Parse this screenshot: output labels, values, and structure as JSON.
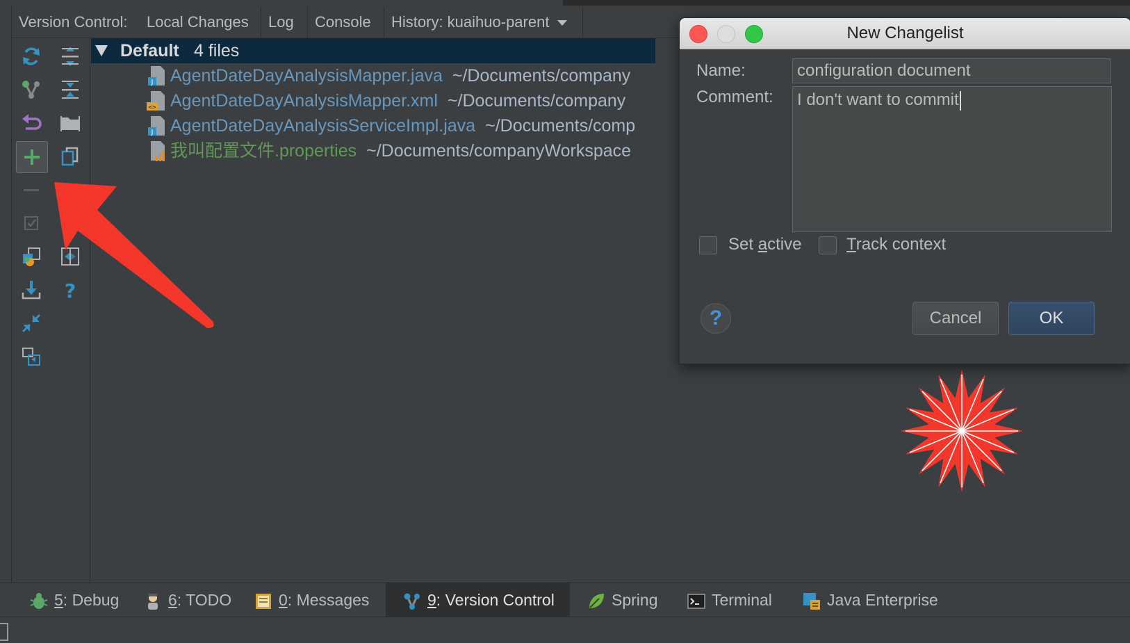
{
  "tabs": {
    "prefix": "Version Control:",
    "local_changes": "Local Changes",
    "log": "Log",
    "console": "Console",
    "history": "History: kuaihuo-parent"
  },
  "changelist": {
    "name": "Default",
    "count": "4 files",
    "files": [
      {
        "name": "AgentDateDayAnalysisMapper.java",
        "path": "~/Documents/company",
        "color": "#6897bb",
        "icon": "java-file-icon"
      },
      {
        "name": "AgentDateDayAnalysisMapper.xml",
        "path": "~/Documents/company",
        "color": "#6897bb",
        "icon": "xml-file-icon"
      },
      {
        "name": "AgentDateDayAnalysisServiceImpl.java",
        "path": "~/Documents/comp",
        "color": "#6897bb",
        "icon": "java-file-icon"
      },
      {
        "name": "我叫配置文件.properties",
        "path": "~/Documents/companyWorkspace",
        "color": "#629755",
        "icon": "properties-file-icon"
      }
    ]
  },
  "dialog": {
    "title": "New Changelist",
    "name_label": "Name:",
    "name_value": "configuration document",
    "comment_label": "Comment:",
    "comment_value": "I don't want to commit",
    "set_active": {
      "pre": "Set ",
      "mn": "a",
      "post": "ctive"
    },
    "track_context": {
      "pre": "",
      "mn": "T",
      "post": "rack context"
    },
    "help": "?",
    "cancel": "Cancel",
    "ok": "OK"
  },
  "bottom_tabs": [
    {
      "num": "5",
      "label": ": Debug",
      "icon": "debug-icon"
    },
    {
      "num": "6",
      "label": ": TODO",
      "icon": "todo-icon"
    },
    {
      "num": "0",
      "label": ": Messages",
      "icon": "messages-icon"
    },
    {
      "num": "9",
      "label": ": Version Control",
      "icon": "version-control-icon",
      "selected": true
    },
    {
      "num": "",
      "label": "Spring",
      "icon": "spring-leaf-icon"
    },
    {
      "num": "",
      "label": "Terminal",
      "icon": "terminal-icon"
    },
    {
      "num": "",
      "label": "Java Enterprise",
      "icon": "java-enterprise-icon"
    }
  ],
  "colors": {
    "accent_red": "#f5362a",
    "tree_selection": "#0d293e",
    "file_blue": "#6897bb",
    "file_green": "#629755"
  }
}
